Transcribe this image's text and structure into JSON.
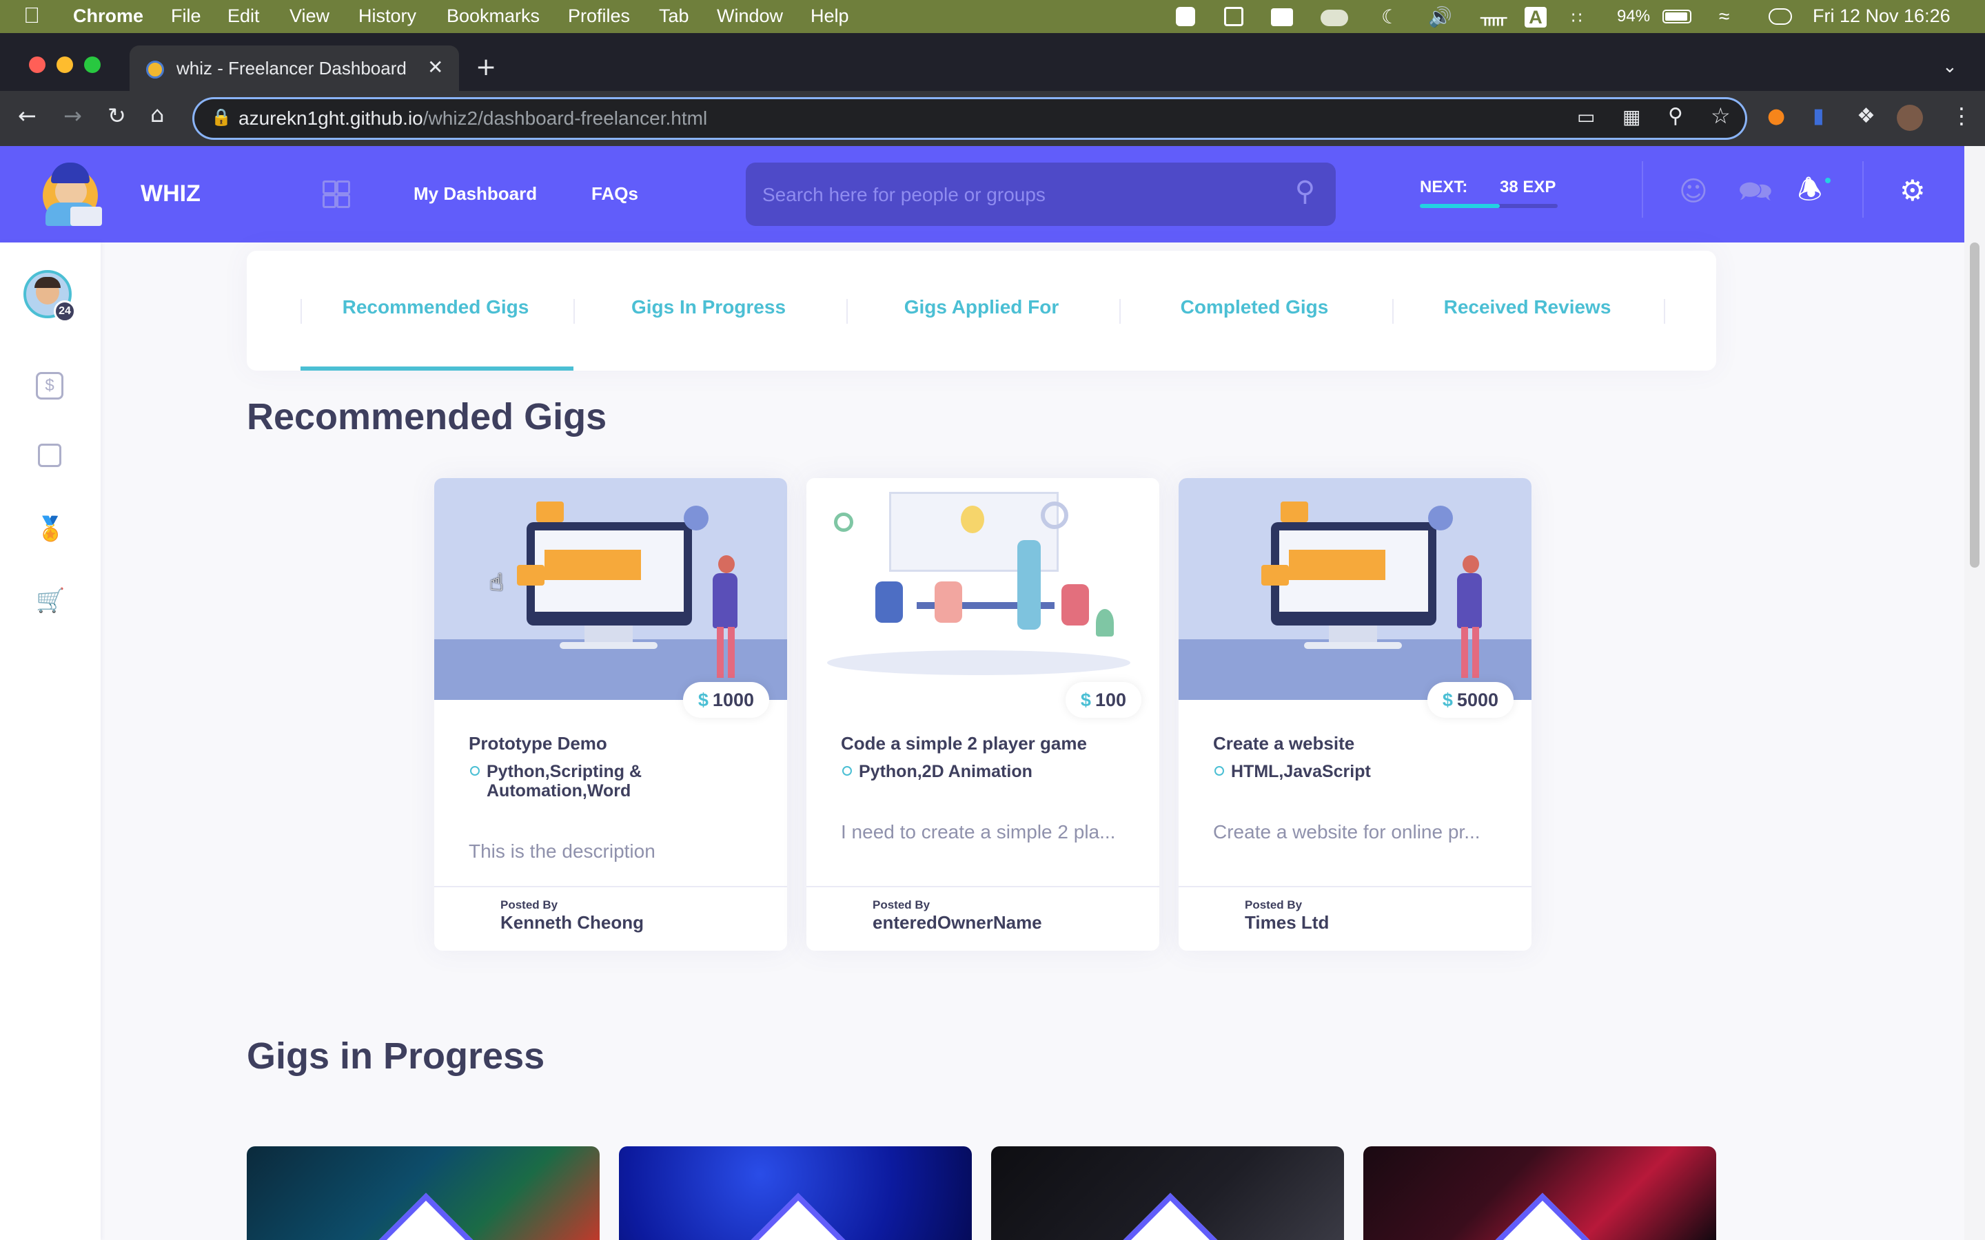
{
  "menubar": {
    "app": "Chrome",
    "items": [
      "File",
      "Edit",
      "View",
      "History",
      "Bookmarks",
      "Profiles",
      "Tab",
      "Window",
      "Help"
    ],
    "battery": "94%",
    "datetime": "Fri 12 Nov  16:26"
  },
  "browser": {
    "tab_title": "whiz - Freelancer Dashboard",
    "url_host": "azurekn1ght.github.io",
    "url_path": "/whiz2/dashboard-freelancer.html"
  },
  "header": {
    "brand": "WHIZ",
    "nav": [
      "My Dashboard",
      "FAQs"
    ],
    "search_placeholder": "Search here for people or groups",
    "next_label": "NEXT:",
    "next_exp": "38 EXP",
    "progress": 0.58
  },
  "profile": {
    "level": "24"
  },
  "gig_tabs": [
    "Recommended Gigs",
    "Gigs In Progress",
    "Gigs Applied For",
    "Completed Gigs",
    "Received Reviews"
  ],
  "sections": {
    "recommended": "Recommended Gigs",
    "in_progress": "Gigs in Progress"
  },
  "gigs": [
    {
      "price": "1000",
      "title": "Prototype Demo",
      "tags": "Python,Scripting & Automation,Word",
      "desc": "This is the description",
      "posted_by_label": "Posted By",
      "poster": "Kenneth Cheong"
    },
    {
      "price": "100",
      "title": "Code a simple 2 player game",
      "tags": "Python,2D Animation",
      "desc": "I need to create a simple 2 pla...",
      "posted_by_label": "Posted By",
      "poster": "enteredOwnerName"
    },
    {
      "price": "5000",
      "title": "Create a website",
      "tags": "HTML,JavaScript",
      "desc": "Create a website for online pr...",
      "posted_by_label": "Posted By",
      "poster": "Times Ltd"
    }
  ],
  "currency_symbol": "$",
  "colors": {
    "brand": "#615dfa",
    "accent": "#4bbfd4",
    "text": "#3e3f5e",
    "muted": "#8f91ac"
  }
}
